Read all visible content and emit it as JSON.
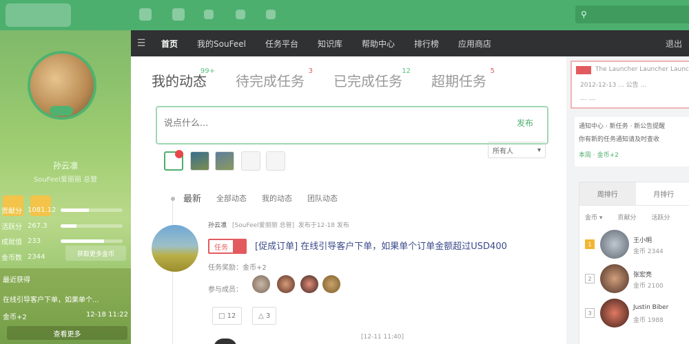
{
  "header": {
    "logo_text": "",
    "search_placeholder": ""
  },
  "profile": {
    "name": "孙云凛",
    "subtitle": "SouFeel爱丽丽 总管",
    "stats": [
      {
        "label": "贡献分",
        "value": "1081.12",
        "progress": 0.45
      },
      {
        "label": "活跃分",
        "value": "267.3",
        "progress": 0.25
      },
      {
        "label": "成就值",
        "value": "233",
        "progress": 0.7
      },
      {
        "label": "金币数",
        "value": "2344",
        "progress": 0
      }
    ],
    "level_button": "获取更多金币",
    "recent_title": "最近获得",
    "recent_text": "在线引导客户下单，如果单个...",
    "recent_reward": "金币+2",
    "recent_time": "12-18 11:22",
    "more_button": "查看更多"
  },
  "nav": {
    "home_icon": "menu-icon",
    "items": [
      "首页",
      "我的SouFeel",
      "任务平台",
      "知识库",
      "帮助中心",
      "排行榜",
      "应用商店"
    ],
    "active": "首页",
    "right": "退出"
  },
  "main": {
    "tabs": [
      {
        "label": "我的动态",
        "badge": "99+"
      },
      {
        "label": "待完成任务",
        "badge": "3"
      },
      {
        "label": "已完成任务",
        "badge": "12"
      },
      {
        "label": "超期任务",
        "badge": "5"
      }
    ],
    "composer_placeholder": "说点什么...",
    "composer_submit": "发布",
    "visibility_select": "所有人",
    "filters": [
      "最新",
      "全部动态",
      "我的动态",
      "团队动态"
    ],
    "post": {
      "author": "孙云凛",
      "author_role": "[SouFeel爱丽丽 总管]",
      "posted": "发布于12-18 发布",
      "tag": "任务",
      "title": "[促成订单] 在线引导客户下单，如果单个订单金额超过USD400",
      "reward": "任务奖励：金币+2",
      "members_label": "参与成员：",
      "comments": "12",
      "likes": "3"
    },
    "next_post_meta": "[12-11 11:40]"
  },
  "right": {
    "notice_title": "The Launcher Launcher Launcher",
    "notice_line1": "2012-12-13 ... 公告 ...",
    "notice_line2": "--- ---",
    "info_line1": "通知中心 · 新任务 · 新公告提醒",
    "info_line2": "你有新的任务通知请及时查收",
    "info_line3": "本周 · 金币+2",
    "rank_tab1": "周排行",
    "rank_tab2": "月排行",
    "rank_sub": [
      "金币 ▾",
      "贡献分",
      "活跃分"
    ],
    "ranks": [
      {
        "num": "1",
        "name": "王小明",
        "score": "金币 2344"
      },
      {
        "num": "2",
        "name": "张宏亮",
        "score": "金币 2100"
      },
      {
        "num": "3",
        "name": "Justin Biber",
        "score": "金币 1988"
      }
    ]
  },
  "colors": {
    "brand": "#4caf6e",
    "nav_bg": "#2f3132",
    "alert": "#e35a5e",
    "gold": "#f2b632"
  }
}
